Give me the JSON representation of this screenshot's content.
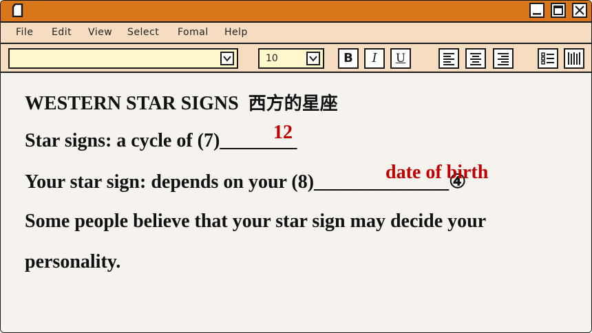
{
  "window": {
    "icons": {
      "app": "document-icon",
      "minimize": "minimize-icon",
      "maximize": "maximize-icon",
      "close": "close-icon"
    }
  },
  "menu": {
    "items": [
      "File",
      "Edit",
      "View",
      "Select",
      "Fomal",
      "Help"
    ]
  },
  "toolbar": {
    "font_value": "",
    "size_value": "10",
    "bold_label": "B",
    "italic_label": "I",
    "underline_label": "U",
    "icons": [
      "align-left-icon",
      "align-center-icon",
      "align-right-icon",
      "list-icon",
      "columns-icon"
    ]
  },
  "document": {
    "heading_en": "WESTERN STAR SIGNS",
    "heading_cn": "西方的星座",
    "line1_text": "Star signs: a cycle of (7)",
    "line1_blank": "________",
    "line1_answer": "12",
    "line2_text": "Your star sign: depends on your (8)",
    "line2_blank": "______________",
    "line2_answer": "date of birth",
    "line2_marker": "④",
    "line3": "Some people believe that your star sign may decide your",
    "line4": "personality."
  },
  "colors": {
    "titlebar": "#d9761a",
    "bars": "#f6dcc1",
    "select_bg": "#fff7cc",
    "answer": "#c00000",
    "page": "#f6f3ef"
  }
}
